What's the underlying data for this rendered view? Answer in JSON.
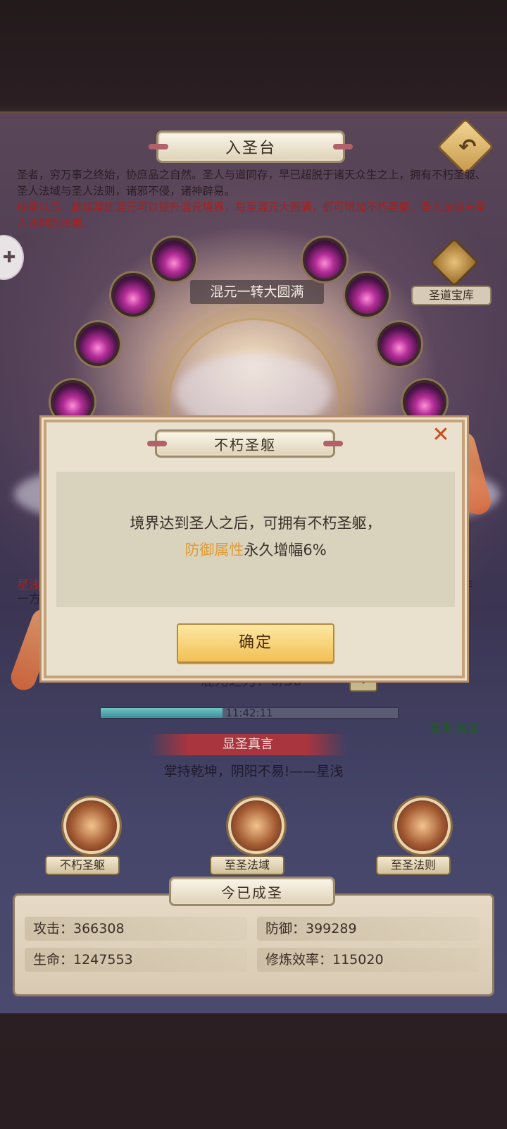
{
  "header": {
    "title": "入圣台",
    "back_icon": "back-arrow-icon"
  },
  "intro": {
    "line1": "圣者，穷万事之终始，协庶品之自然。圣人与道同存，早已超脱于诸天众生之上，拥有不朽圣躯、圣人法域与圣人法则，诸邪不侵，诸神辟易。",
    "line2": "成圣以后，继续凝练混元可以提升混元境界，每至混元大圆满，都可增加不朽圣躯、圣人法域与圣人法则的效果。"
  },
  "treasury": {
    "label": "圣道宝库",
    "icon": "treasure-vault-icon"
  },
  "stage_banner": "混元一转大圆满",
  "side_text": {
    "left1": "星浅",
    "left2": "一方",
    "right": "作"
  },
  "force": {
    "label": "混元之力：0/30",
    "plus": "+"
  },
  "timer": {
    "text": "11:42:11",
    "progress": 0.41
  },
  "copy_link": "复制真言",
  "words_banner": "显圣真言",
  "quote": "掌持乾坤，阴阳不易!——星浅",
  "skills": [
    {
      "label": "不朽圣躯"
    },
    {
      "label": "至圣法域"
    },
    {
      "label": "至圣法则"
    }
  ],
  "stats": {
    "title": "今已成圣",
    "attack": "攻击：366308",
    "defense": "防御：399289",
    "life": "生命：1247553",
    "efficiency": "修炼效率：115020"
  },
  "modal": {
    "title": "不朽圣躯",
    "line1": "境界达到圣人之后，可拥有不朽圣躯，",
    "highlight": "防御属性",
    "line2_rest": "永久增幅6%",
    "confirm": "确定",
    "close_icon": "close-icon"
  },
  "colors": {
    "highlight": "#e09b34",
    "intro_red": "#a5201e",
    "panel": "#4a3a52"
  }
}
